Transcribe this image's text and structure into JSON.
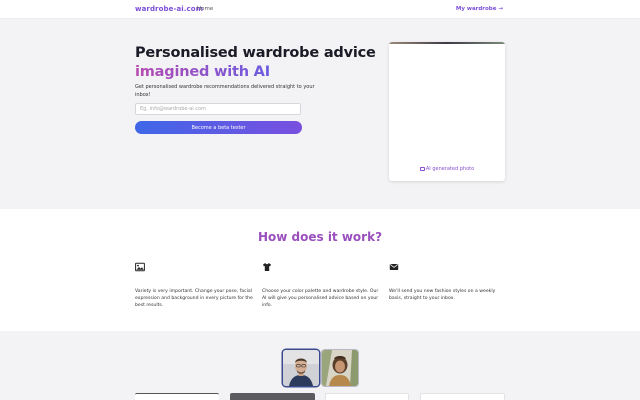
{
  "header": {
    "brand": "wardrobe-ai.com",
    "nav_home": "Home",
    "nav_right": "My wardrobe →"
  },
  "hero": {
    "title_line1": "Personalised wardrobe advice",
    "title_line2": "imagined with AI",
    "subtitle": "Get personalised wardrobe recommendations delivered straight to your inbox!",
    "email_placeholder": "Eg. info@wardrobe-ai.com",
    "cta_label": "Become a beta tester",
    "photo_caption": "AI generated photo"
  },
  "how": {
    "title": "How does it work?",
    "steps": [
      {
        "icon": "image-icon",
        "text": "Variety is very important. Change your pose, facial expression and background in every picture for the best results."
      },
      {
        "icon": "tshirt-icon",
        "text": "Choose your color palette and wardrobe style. Our AI will give you personalised advice based on your info."
      },
      {
        "icon": "envelope-icon",
        "text": "We'll send you new fashion styles on a weekly basis, straight to your inbox."
      }
    ]
  },
  "colors": {
    "accent": "#7c4fd8",
    "how_title": "#9a4fbe",
    "cta_start": "#3f67e8",
    "cta_end": "#7a4fe0",
    "hero_bg": "#f3f2f4"
  }
}
